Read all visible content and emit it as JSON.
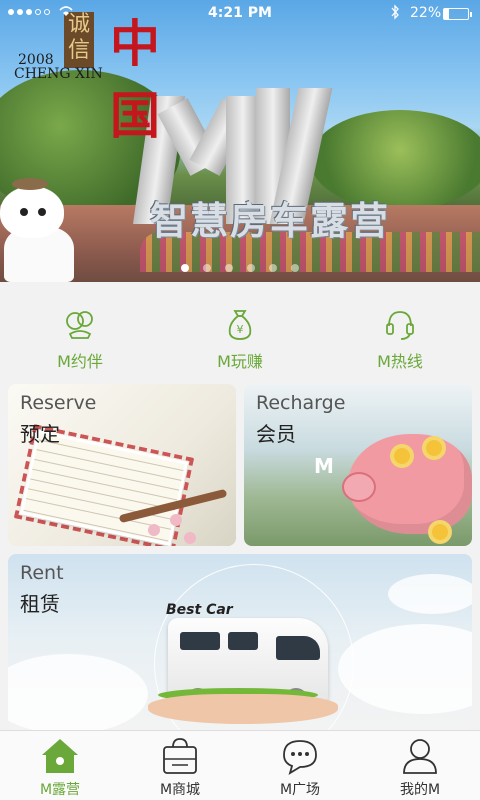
{
  "status_bar": {
    "time": "4:21 PM",
    "battery_percent": "22%",
    "battery_level": 0.22
  },
  "banner": {
    "logo_year": "2008",
    "logo_name": "CHENG XIN",
    "logo_box_text": "诚信",
    "logo_red_text": "中国",
    "sign_text": "智慧房车露营",
    "page_count": 6,
    "active_page": 0
  },
  "quick_actions": [
    {
      "label": "M约伴",
      "icon": "friends-icon"
    },
    {
      "label": "M玩赚",
      "icon": "money-bag-icon"
    },
    {
      "label": "M热线",
      "icon": "headset-icon"
    }
  ],
  "cards": {
    "reserve": {
      "en": "Reserve",
      "zh": "预定"
    },
    "recharge": {
      "en": "Recharge",
      "zh": "会员"
    },
    "rent": {
      "en": "Rent",
      "zh": "租赁",
      "badge": "Best Car"
    }
  },
  "tabs": [
    {
      "label": "M露营",
      "icon": "home-icon",
      "active": true
    },
    {
      "label": "M商城",
      "icon": "shopping-bag-icon",
      "active": false
    },
    {
      "label": "M广场",
      "icon": "chat-icon",
      "active": false
    },
    {
      "label": "我的M",
      "icon": "user-icon",
      "active": false
    }
  ],
  "colors": {
    "accent_green": "#6aa83a",
    "tab_active": "#6aa83a"
  }
}
